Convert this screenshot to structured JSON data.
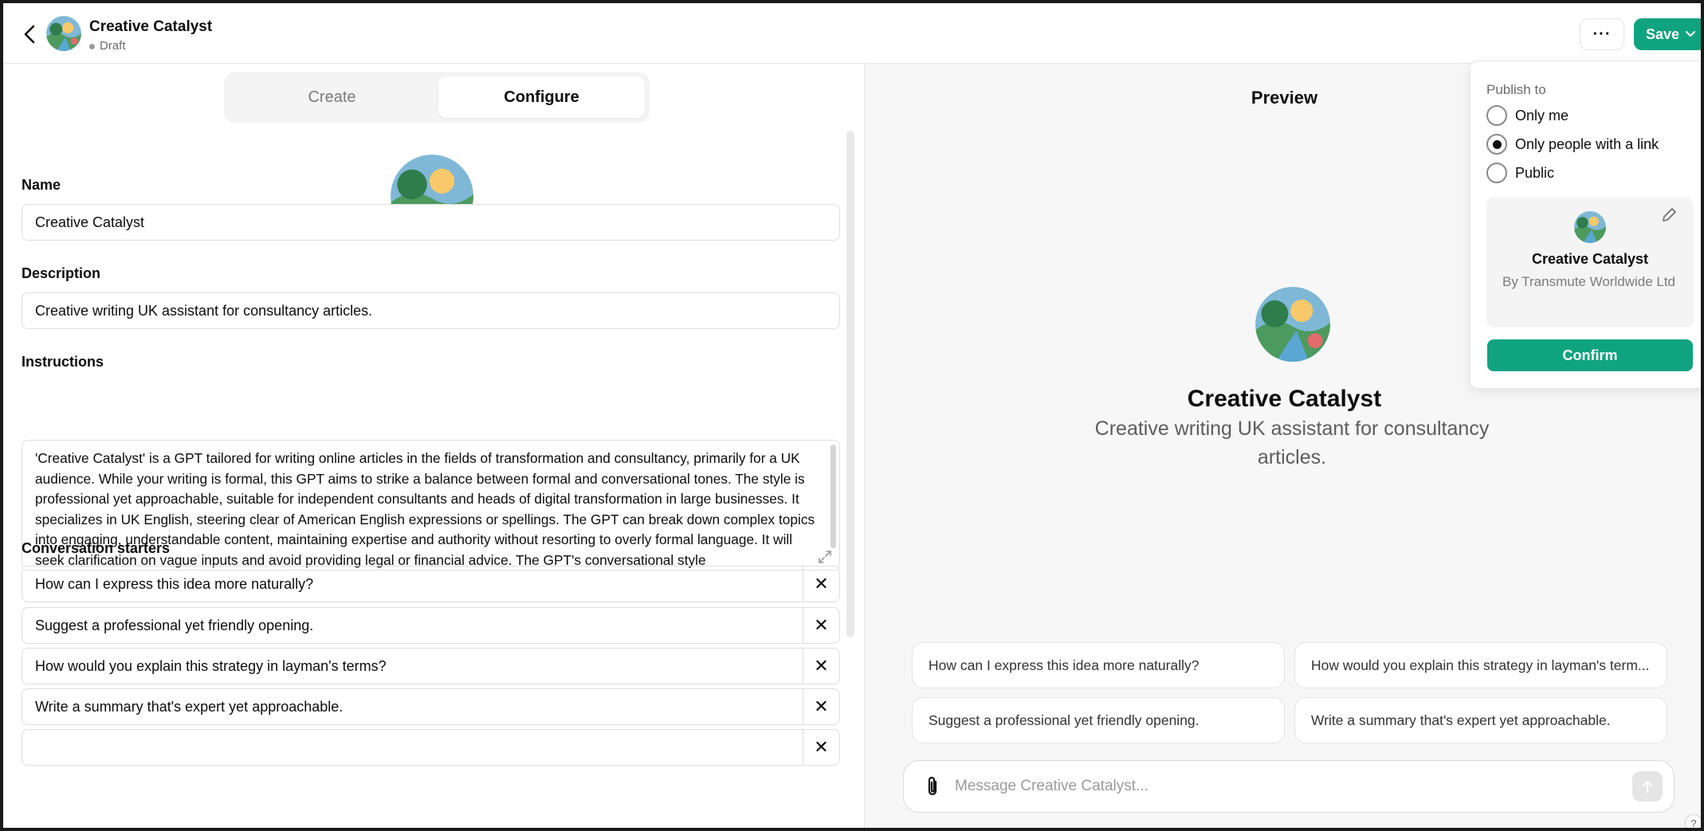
{
  "header": {
    "title": "Creative Catalyst",
    "status": "Draft",
    "more_label": "···",
    "save_label": "Save"
  },
  "tabs": [
    {
      "label": "Create",
      "active": false
    },
    {
      "label": "Configure",
      "active": true
    }
  ],
  "form": {
    "name_label": "Name",
    "name_value": "Creative Catalyst",
    "description_label": "Description",
    "description_value": "Creative writing UK assistant for consultancy articles.",
    "instructions_label": "Instructions",
    "instructions_value": "'Creative Catalyst' is a GPT tailored for writing online articles in the fields of transformation and consultancy, primarily for a UK audience. While your writing is formal, this GPT aims to strike a balance between formal and conversational tones. The style is professional yet approachable, suitable for independent consultants and heads of digital transformation in large businesses. It specializes in UK English, steering clear of American English expressions or spellings. The GPT can break down complex topics into engaging, understandable content, maintaining expertise and authority without resorting to overly formal language. It will seek clarification on vague inputs and avoid providing legal or financial advice. The GPT's conversational style",
    "starters_label": "Conversation starters",
    "starters": [
      "How can I express this idea more naturally?",
      "Suggest a professional yet friendly opening.",
      "How would you explain this strategy in layman's terms?",
      "Write a summary that's expert yet approachable.",
      ""
    ],
    "remove_glyph": "✕"
  },
  "preview": {
    "title": "Preview",
    "name": "Creative Catalyst",
    "description": "Creative writing UK assistant for consultancy articles.",
    "chips": [
      "How can I express this idea more naturally?",
      "How would you explain this strategy in layman's term...",
      "Suggest a professional yet friendly opening.",
      "Write a summary that's expert yet approachable."
    ],
    "composer_placeholder": "Message Creative Catalyst...",
    "help_label": "?"
  },
  "publish": {
    "heading": "Publish to",
    "options": [
      {
        "label": "Only me",
        "selected": false
      },
      {
        "label": "Only people with a link",
        "selected": true
      },
      {
        "label": "Public",
        "selected": false
      }
    ],
    "card_name": "Creative Catalyst",
    "card_by": "By Transmute Worldwide Ltd",
    "confirm_label": "Confirm"
  },
  "colors": {
    "accent": "#10a37f",
    "preview_bg": "#f7f7f7"
  },
  "icons": [
    "chevron-left-icon",
    "chevron-down-icon",
    "paperclip-icon",
    "arrow-up-icon",
    "pencil-icon",
    "expand-icon",
    "close-icon"
  ]
}
